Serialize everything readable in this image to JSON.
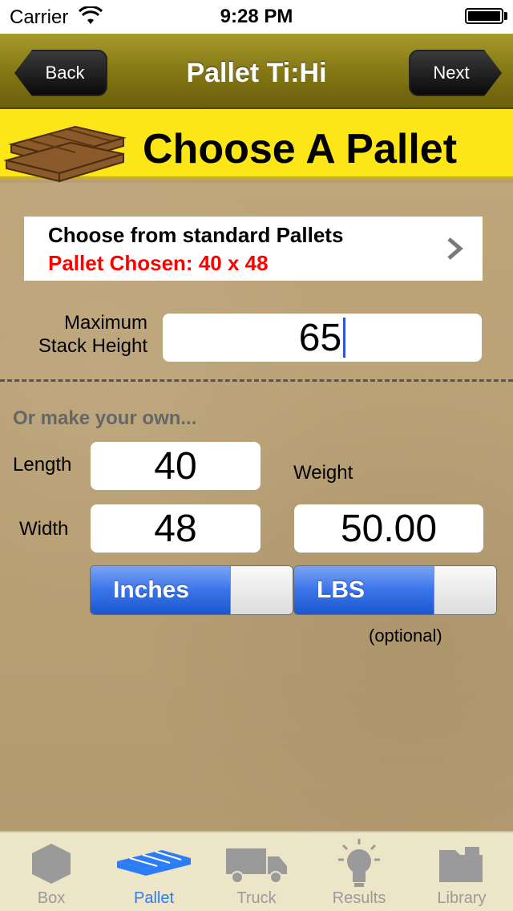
{
  "status_bar": {
    "carrier": "Carrier",
    "time": "9:28 PM"
  },
  "nav": {
    "back_label": "Back",
    "title": "Pallet Ti:Hi",
    "next_label": "Next"
  },
  "banner": {
    "title": "Choose A Pallet"
  },
  "standard_pallets": {
    "line1": "Choose from standard Pallets",
    "line2": "Pallet Chosen: 40 x 48"
  },
  "stack": {
    "label_line1": "Maximum",
    "label_line2": "Stack Height",
    "value": "65"
  },
  "custom": {
    "heading": "Or make your own...",
    "length_label": "Length",
    "length_value": "40",
    "width_label": "Width",
    "width_value": "48",
    "weight_label": "Weight",
    "weight_value": "50.00",
    "units_toggle": "Inches",
    "weight_units_toggle": "LBS",
    "optional_label": "(optional)"
  },
  "tabs": [
    {
      "label": "Box",
      "icon": "box-icon",
      "active": false
    },
    {
      "label": "Pallet",
      "icon": "pallet-icon",
      "active": true
    },
    {
      "label": "Truck",
      "icon": "truck-icon",
      "active": false
    },
    {
      "label": "Results",
      "icon": "lightbulb-icon",
      "active": false
    },
    {
      "label": "Library",
      "icon": "folder-icon",
      "active": false
    }
  ],
  "colors": {
    "nav_bar": "#857815",
    "banner": "#fde617",
    "chosen_text": "#ff0000",
    "toggle_on": "#3a74ea",
    "tab_active": "#2b7cf6",
    "tab_inactive": "#9a9a9a"
  }
}
